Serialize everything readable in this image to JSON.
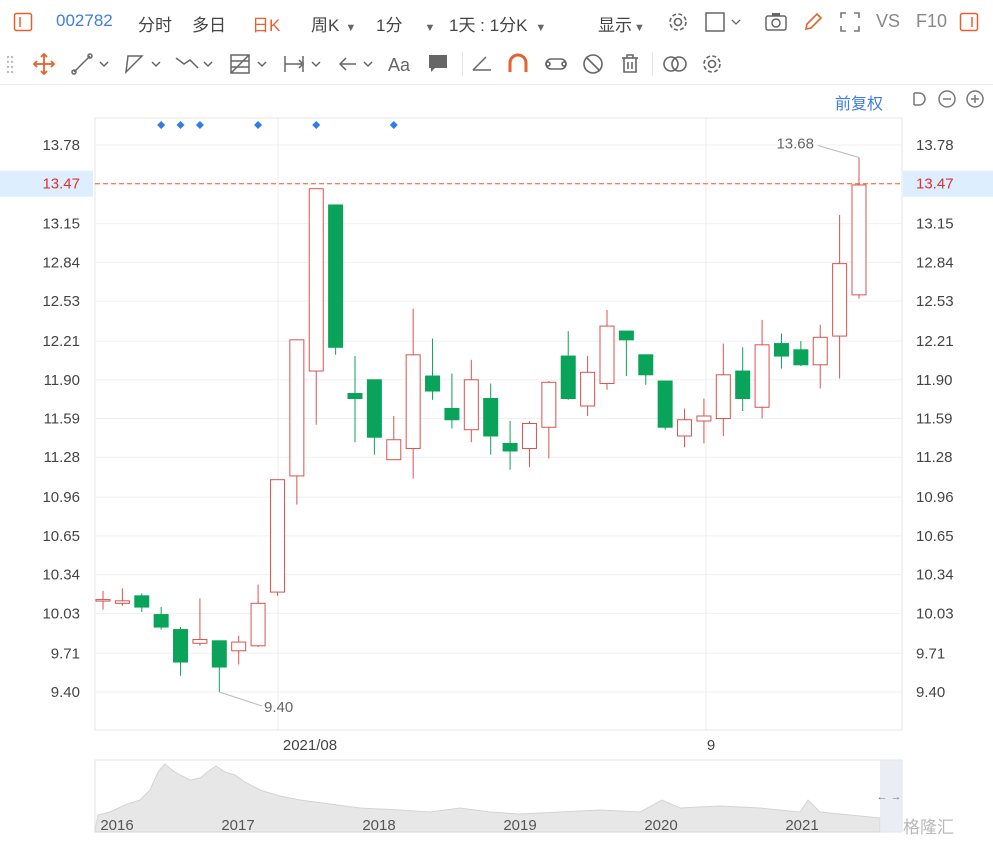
{
  "toolbar": {
    "stock_code": "002782",
    "tab_intraday": "分时",
    "tab_multiday": "多日",
    "tab_daily": "日K",
    "tab_weekly": "周K",
    "tab_minute": "1分",
    "tab_combo": "1天 : 1分K",
    "display_label": "显示",
    "vs_label": "VS",
    "f10_label": "F10"
  },
  "adjust_label": "前复权",
  "watermark": "格隆汇",
  "colors": {
    "up": "#d9534f",
    "down": "#0aa35a",
    "accent": "#3d7ee0",
    "current": "#e8612c"
  },
  "chart_data": {
    "type": "candlestick",
    "y_ticks": [
      13.78,
      13.47,
      13.15,
      12.84,
      12.53,
      12.21,
      11.9,
      11.59,
      11.28,
      10.96,
      10.65,
      10.34,
      10.03,
      9.71,
      9.4
    ],
    "y_tick_labels": [
      "13.78",
      "13.47",
      "13.15",
      "12.84",
      "12.53",
      "12.21",
      "11.90",
      "11.59",
      "11.28",
      "10.96",
      "10.65",
      "10.34",
      "10.03",
      "9.71",
      "9.40"
    ],
    "ylim": [
      9.1,
      14.0
    ],
    "current_price": "13.47",
    "max_label": "13.68",
    "min_label": "9.40",
    "x_labels": [
      "2021/08",
      "9"
    ],
    "overview_labels": [
      "2016",
      "2017",
      "2018",
      "2019",
      "2020",
      "2021"
    ],
    "markers": 6,
    "candles": [
      {
        "o": 10.14,
        "c": 10.14,
        "h": 10.21,
        "l": 10.06
      },
      {
        "o": 10.11,
        "c": 10.13,
        "h": 10.23,
        "l": 10.09
      },
      {
        "o": 10.17,
        "c": 10.08,
        "h": 10.19,
        "l": 10.04
      },
      {
        "o": 10.02,
        "c": 9.92,
        "h": 10.08,
        "l": 9.9
      },
      {
        "o": 9.9,
        "c": 9.64,
        "h": 9.92,
        "l": 9.53
      },
      {
        "o": 9.79,
        "c": 9.82,
        "h": 10.15,
        "l": 9.77
      },
      {
        "o": 9.81,
        "c": 9.6,
        "h": 9.81,
        "l": 9.4
      },
      {
        "o": 9.73,
        "c": 9.8,
        "h": 9.85,
        "l": 9.62
      },
      {
        "o": 9.77,
        "c": 10.11,
        "h": 10.26,
        "l": 9.76
      },
      {
        "o": 10.2,
        "c": 11.1,
        "h": 11.1,
        "l": 10.17
      },
      {
        "o": 11.13,
        "c": 12.22,
        "h": 12.22,
        "l": 10.9
      },
      {
        "o": 11.97,
        "c": 13.43,
        "h": 13.43,
        "l": 11.54
      },
      {
        "o": 13.3,
        "c": 12.16,
        "h": 13.3,
        "l": 12.1
      },
      {
        "o": 11.79,
        "c": 11.75,
        "h": 12.09,
        "l": 11.4
      },
      {
        "o": 11.9,
        "c": 11.44,
        "h": 11.9,
        "l": 11.3
      },
      {
        "o": 11.26,
        "c": 11.42,
        "h": 11.61,
        "l": 11.26
      },
      {
        "o": 11.35,
        "c": 12.1,
        "h": 12.47,
        "l": 11.11
      },
      {
        "o": 11.93,
        "c": 11.81,
        "h": 12.23,
        "l": 11.74
      },
      {
        "o": 11.67,
        "c": 11.58,
        "h": 11.95,
        "l": 11.51
      },
      {
        "o": 11.5,
        "c": 11.9,
        "h": 12.06,
        "l": 11.4
      },
      {
        "o": 11.75,
        "c": 11.45,
        "h": 11.87,
        "l": 11.3
      },
      {
        "o": 11.39,
        "c": 11.33,
        "h": 11.57,
        "l": 11.18
      },
      {
        "o": 11.35,
        "c": 11.55,
        "h": 11.57,
        "l": 11.2
      },
      {
        "o": 11.52,
        "c": 11.88,
        "h": 11.89,
        "l": 11.27
      },
      {
        "o": 12.09,
        "c": 11.75,
        "h": 12.29,
        "l": 11.74
      },
      {
        "o": 11.69,
        "c": 11.96,
        "h": 12.09,
        "l": 11.61
      },
      {
        "o": 11.87,
        "c": 12.33,
        "h": 12.46,
        "l": 11.82
      },
      {
        "o": 12.29,
        "c": 12.22,
        "h": 12.29,
        "l": 11.93
      },
      {
        "o": 12.1,
        "c": 11.94,
        "h": 12.1,
        "l": 11.86
      },
      {
        "o": 11.89,
        "c": 11.52,
        "h": 11.89,
        "l": 11.5
      },
      {
        "o": 11.45,
        "c": 11.58,
        "h": 11.67,
        "l": 11.36
      },
      {
        "o": 11.57,
        "c": 11.61,
        "h": 11.75,
        "l": 11.39
      },
      {
        "o": 11.59,
        "c": 11.94,
        "h": 12.19,
        "l": 11.45
      },
      {
        "o": 11.97,
        "c": 11.75,
        "h": 12.16,
        "l": 11.65
      },
      {
        "o": 11.68,
        "c": 12.18,
        "h": 12.38,
        "l": 11.59
      },
      {
        "o": 12.19,
        "c": 12.09,
        "h": 12.27,
        "l": 11.99
      },
      {
        "o": 12.14,
        "c": 12.02,
        "h": 12.21,
        "l": 12.01
      },
      {
        "o": 12.02,
        "c": 12.24,
        "h": 12.34,
        "l": 11.83
      },
      {
        "o": 12.25,
        "c": 12.83,
        "h": 13.22,
        "l": 11.91
      },
      {
        "o": 12.58,
        "c": 13.46,
        "h": 13.68,
        "l": 12.55
      }
    ]
  }
}
